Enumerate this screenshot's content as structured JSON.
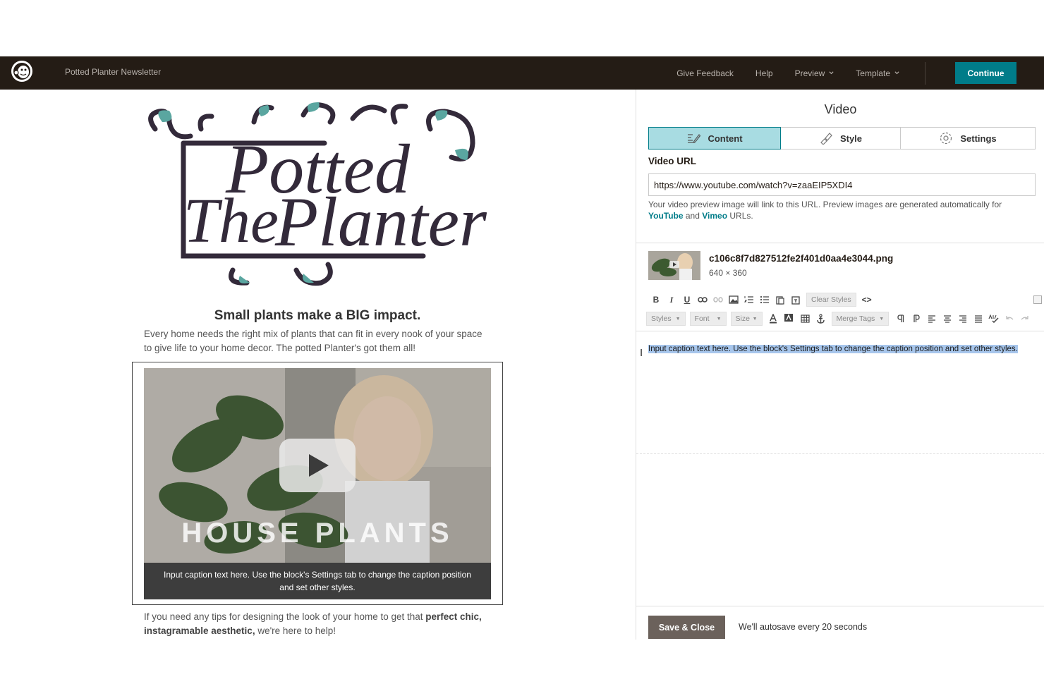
{
  "topbar": {
    "campaign_name": "Potted Planter Newsletter",
    "nav": {
      "feedback": "Give Feedback",
      "help": "Help",
      "preview": "Preview",
      "template": "Template"
    },
    "continue_label": "Continue",
    "accent": "#007c89"
  },
  "preview": {
    "headline": "Small plants make a BIG impact.",
    "intro": "Every home needs the right mix of plants that can fit in every nook of your space to give life to your home decor. The potted Planter's got them all!",
    "video_title": "HOUSE PLANTS",
    "caption": "Input caption text here. Use the block's Settings tab to change the caption position and set other styles.",
    "closing_start": "If you need any tips for designing the look of your home to get that ",
    "closing_bold": "perfect chic, instagramable aesthetic,",
    "closing_end": " we're here to help!"
  },
  "panel": {
    "title": "Video",
    "tabs": {
      "content": "Content",
      "style": "Style",
      "settings": "Settings"
    },
    "video_url_label": "Video URL",
    "video_url_value": "https://www.youtube.com/watch?v=zaaEIP5XDI4",
    "help_text_1": "Your video preview image will link to this URL. Preview images are generated automatically for ",
    "help_youtube": "YouTube",
    "help_and": " and ",
    "help_vimeo": "Vimeo",
    "help_end": " URLs.",
    "file_name": "c106c8f7d827512fe2f401d0aa4e3044.png",
    "file_dims": "640 × 360",
    "toolbar": {
      "bold": "B",
      "italic": "I",
      "underline": "U",
      "clear_styles": "Clear Styles",
      "source": "<>",
      "styles": "Styles",
      "font": "Font",
      "size": "Size",
      "merge_tags": "Merge Tags"
    },
    "caption_text": "Input caption text here. Use the block's Settings tab to change the caption position and set other styles.",
    "save_label": "Save & Close",
    "autosave": "We'll autosave every 20 seconds"
  }
}
